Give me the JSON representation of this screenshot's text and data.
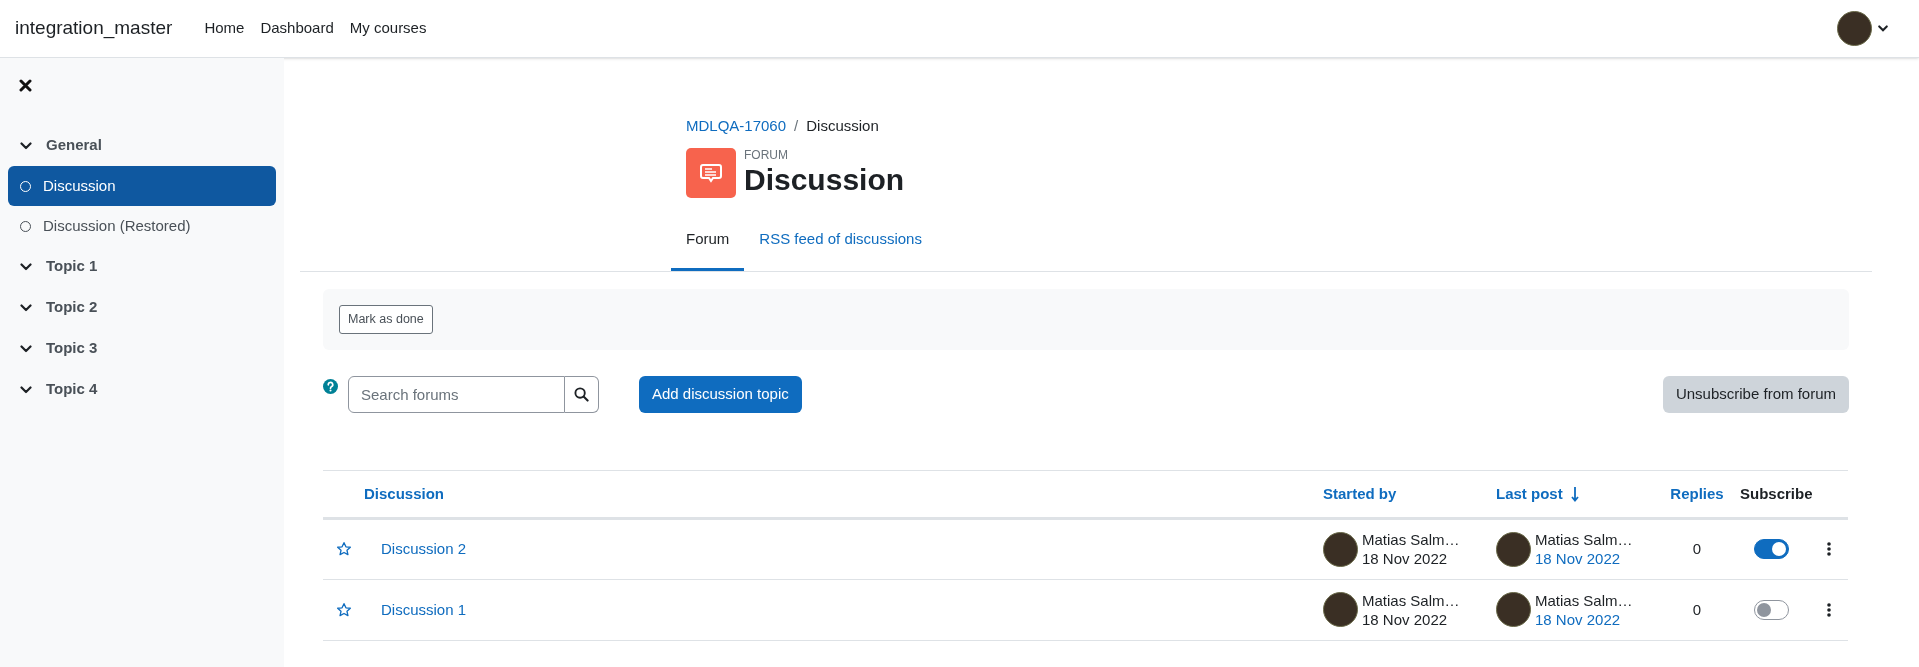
{
  "navbar": {
    "site_name": "integration_master",
    "links": [
      "Home",
      "Dashboard",
      "My courses"
    ]
  },
  "sidebar": {
    "sections": [
      {
        "label": "General",
        "children": [
          {
            "label": "Discussion",
            "selected": true
          },
          {
            "label": "Discussion (Restored)",
            "selected": false
          }
        ]
      },
      {
        "label": "Topic 1"
      },
      {
        "label": "Topic 2"
      },
      {
        "label": "Topic 3"
      },
      {
        "label": "Topic 4"
      }
    ]
  },
  "breadcrumb": {
    "separator": "/",
    "items": [
      "MDLQA-17060",
      "Discussion"
    ]
  },
  "header": {
    "kicker": "FORUM",
    "title": "Discussion"
  },
  "tabs": [
    {
      "label": "Forum",
      "selected": true
    },
    {
      "label": "RSS feed of discussions",
      "selected": false
    }
  ],
  "completion": {
    "button": "Mark as done"
  },
  "search": {
    "placeholder": "Search forums"
  },
  "add_button": "Add discussion topic",
  "unsubscribe_button": "Unsubscribe from forum",
  "table": {
    "columns": [
      {
        "label": "Discussion",
        "sortable": true,
        "sorted": false
      },
      {
        "label": "Started by",
        "sortable": true,
        "sorted": false
      },
      {
        "label": "Last post",
        "sortable": true,
        "sorted": true
      },
      {
        "label": "Replies",
        "sortable": true,
        "sorted": false
      },
      {
        "label": "Subscribe",
        "sortable": false,
        "sorted": false
      }
    ],
    "rows": [
      {
        "title": "Discussion 2",
        "started_by": {
          "name": "Matias Salm…",
          "date": "18 Nov 2022"
        },
        "last_post": {
          "name": "Matias Salm…",
          "date": "18 Nov 2022"
        },
        "replies": "0",
        "subscribed": true
      },
      {
        "title": "Discussion 1",
        "started_by": {
          "name": "Matias Salm…",
          "date": "18 Nov 2022"
        },
        "last_post": {
          "name": "Matias Salm…",
          "date": "18 Nov 2022"
        },
        "replies": "0",
        "subscribed": false
      }
    ]
  }
}
